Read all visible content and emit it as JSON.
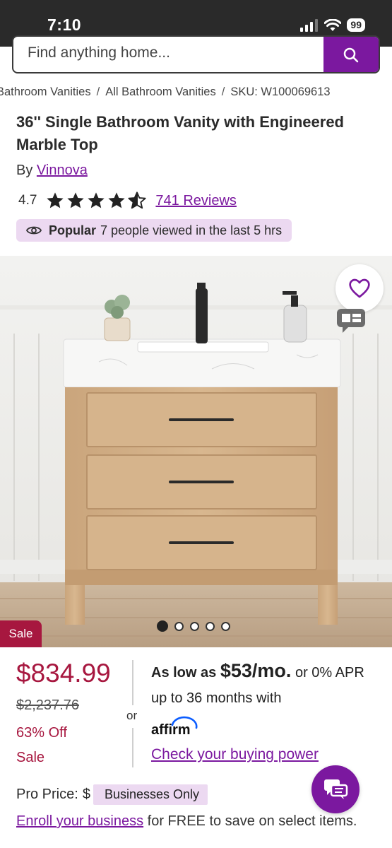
{
  "status_bar": {
    "time": "7:10",
    "battery": "99"
  },
  "search": {
    "placeholder": "Find anything home..."
  },
  "breadcrumb": [
    "Bathroom Vanities",
    "All Bathroom Vanities",
    "SKU: W100069613"
  ],
  "product": {
    "title": "36'' Single Bathroom Vanity with Engineered Marble Top",
    "by_label": "By",
    "brand": "Vinnova",
    "rating": "4.7",
    "stars": 4.7,
    "reviews": "741 Reviews",
    "popular_label": "Popular",
    "popular_text": "7 people viewed in the last 5 hrs",
    "sale_tag": "Sale",
    "image_count": 5,
    "image_index": 1
  },
  "pricing": {
    "price": "$834.99",
    "original_price": "$2,237.76",
    "discount": "63% Off",
    "sale": "Sale",
    "or": "or"
  },
  "financing": {
    "as_low_as": "As low as",
    "monthly": "$53/mo.",
    "text_after": "or 0% APR up to 36 months with",
    "provider": "affirm",
    "check_link": "Check your buying power"
  },
  "pro": {
    "label": "Pro Price:",
    "price_partial": "$",
    "businesses_only": "Businesses Only",
    "enroll_link": "Enroll your business",
    "enroll_text": "for FREE to save on select items."
  },
  "colors": {
    "brand": "#7b189f",
    "sale": "#a7173f",
    "pill": "#ecd9f1"
  },
  "icons": [
    "search-icon",
    "star-icon",
    "eye-icon",
    "heart-icon",
    "compare-icon",
    "chat-icon",
    "signal-icon",
    "wifi-icon"
  ]
}
